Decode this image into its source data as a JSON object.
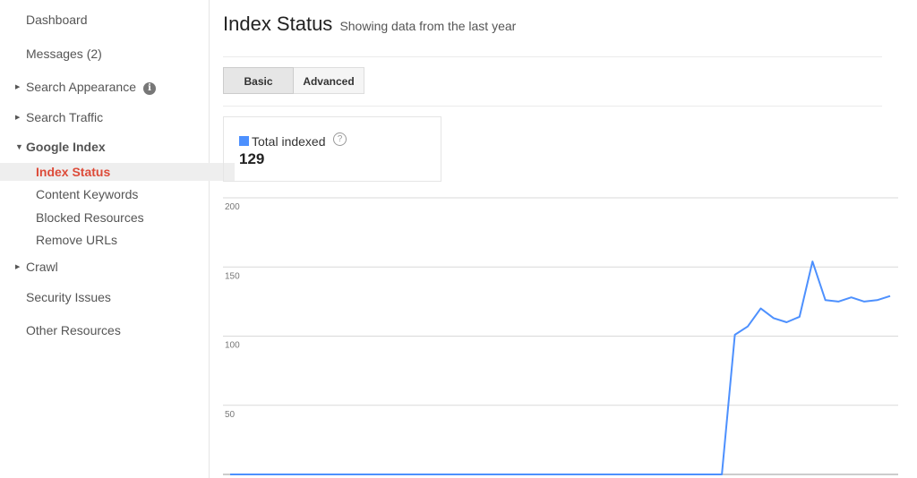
{
  "sidebar": {
    "items": [
      {
        "label": "Dashboard",
        "type": "top"
      },
      {
        "label": "Messages (2)",
        "type": "top"
      },
      {
        "label": "Search Appearance",
        "type": "collapsed",
        "info": true
      },
      {
        "label": "Search Traffic",
        "type": "collapsed"
      },
      {
        "label": "Google Index",
        "type": "expanded"
      },
      {
        "label": "Index Status",
        "type": "child",
        "active": true
      },
      {
        "label": "Content Keywords",
        "type": "child"
      },
      {
        "label": "Blocked Resources",
        "type": "child"
      },
      {
        "label": "Remove URLs",
        "type": "child"
      },
      {
        "label": "Crawl",
        "type": "collapsed"
      },
      {
        "label": "Security Issues",
        "type": "top"
      },
      {
        "label": "Other Resources",
        "type": "top"
      }
    ]
  },
  "header": {
    "title": "Index Status",
    "subtitle": "Showing data from the last year"
  },
  "tabs": [
    {
      "label": "Basic",
      "selected": true
    },
    {
      "label": "Advanced",
      "selected": false
    }
  ],
  "stat": {
    "label": "Total indexed",
    "value": "129",
    "color": "#4d90fe"
  },
  "chart_data": {
    "type": "line",
    "title": "",
    "xlabel": "",
    "ylabel": "",
    "ylim": [
      0,
      200
    ],
    "y_ticks": [
      200,
      150,
      100,
      50
    ],
    "grid": true,
    "series": [
      {
        "name": "Total indexed",
        "color": "#4d90fe",
        "values": [
          0,
          0,
          0,
          0,
          0,
          0,
          0,
          0,
          0,
          0,
          0,
          0,
          0,
          0,
          0,
          0,
          0,
          0,
          0,
          0,
          0,
          0,
          0,
          0,
          0,
          0,
          0,
          0,
          0,
          0,
          0,
          0,
          0,
          0,
          0,
          0,
          0,
          0,
          0,
          101,
          107,
          120,
          113,
          110,
          114,
          154,
          126,
          125,
          128,
          125,
          126,
          129
        ]
      }
    ]
  }
}
